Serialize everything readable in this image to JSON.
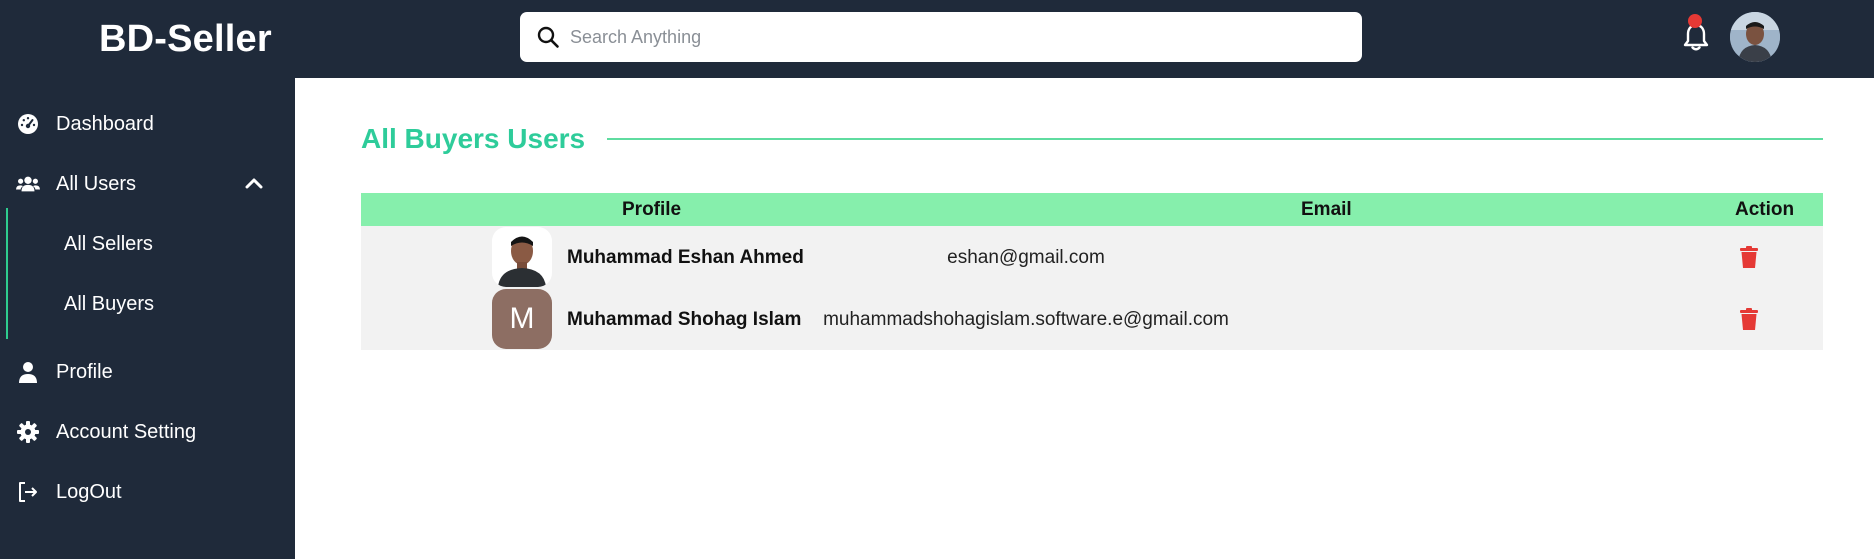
{
  "app": {
    "brand": "BD-Seller"
  },
  "search": {
    "placeholder": "Search Anything",
    "value": ""
  },
  "header": {
    "notification_icon": "bell-icon",
    "has_notification": true
  },
  "sidebar": {
    "items": [
      {
        "label": "Dashboard",
        "icon": "gauge-icon"
      },
      {
        "label": "All Users",
        "icon": "users-icon",
        "expanded": true
      },
      {
        "label": "Profile",
        "icon": "user-icon"
      },
      {
        "label": "Account Setting",
        "icon": "gear-icon"
      },
      {
        "label": "LogOut",
        "icon": "logout-icon"
      }
    ],
    "sub_items": [
      {
        "label": "All Sellers"
      },
      {
        "label": "All Buyers"
      }
    ]
  },
  "main": {
    "title": "All Buyers Users",
    "table": {
      "headers": {
        "profile": "Profile",
        "email": "Email",
        "action": "Action"
      },
      "rows": [
        {
          "name": "Muhammad Eshan Ahmed",
          "email": "eshan@gmail.com",
          "avatar": "photo"
        },
        {
          "name": "Muhammad Shohag Islam",
          "email": "muhammadshohagislam.software.e@gmail.com",
          "avatar": "M"
        }
      ]
    }
  },
  "colors": {
    "sidebar": "#1f2a3a",
    "accent": "#2ecc9a",
    "table_header": "#86efac",
    "delete": "#e53935"
  }
}
